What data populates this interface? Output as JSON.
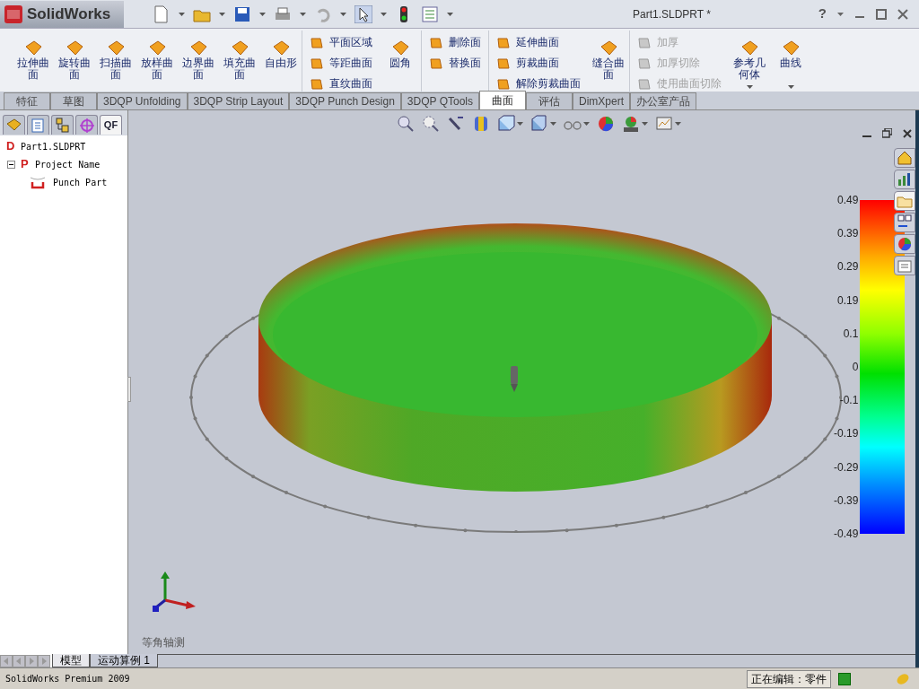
{
  "title_bar": {
    "logo": "SolidWorks",
    "title": "Part1.SLDPRT *",
    "help": "?"
  },
  "ribbon": [
    {
      "kind": "big",
      "label": "拉伸曲面",
      "disabled": false
    },
    {
      "kind": "big",
      "label": "旋转曲面",
      "disabled": false
    },
    {
      "kind": "big",
      "label": "扫描曲面",
      "disabled": false
    },
    {
      "kind": "big",
      "label": "放样曲面",
      "disabled": false
    },
    {
      "kind": "big",
      "label": "边界曲面",
      "disabled": false
    },
    {
      "kind": "big",
      "label": "填充曲面",
      "disabled": false
    },
    {
      "kind": "big",
      "label": "自由形",
      "disabled": false
    },
    {
      "kind": "column",
      "items": [
        {
          "label": "平面区域",
          "disabled": false
        },
        {
          "label": "等距曲面",
          "disabled": false
        },
        {
          "label": "直纹曲面",
          "disabled": false
        }
      ]
    },
    {
      "kind": "big",
      "label": "圆角",
      "disabled": false
    },
    {
      "kind": "column",
      "items": [
        {
          "label": "删除面",
          "disabled": false
        },
        {
          "label": "替换面",
          "disabled": false
        }
      ]
    },
    {
      "kind": "column",
      "items": [
        {
          "label": "延伸曲面",
          "disabled": false
        },
        {
          "label": "剪裁曲面",
          "disabled": false
        },
        {
          "label": "解除剪裁曲面",
          "disabled": false
        }
      ]
    },
    {
      "kind": "big",
      "label": "缝合曲面",
      "disabled": false
    },
    {
      "kind": "column",
      "items": [
        {
          "label": "加厚",
          "disabled": true
        },
        {
          "label": "加厚切除",
          "disabled": true
        },
        {
          "label": "使用曲面切除",
          "disabled": true
        }
      ]
    },
    {
      "kind": "dropdown",
      "label": "参考几何体",
      "disabled": false
    },
    {
      "kind": "dropdown",
      "label": "曲线",
      "disabled": false
    }
  ],
  "tabs": [
    {
      "label": "特征",
      "selected": false
    },
    {
      "label": "草图",
      "selected": false
    },
    {
      "label": "3DQP Unfolding",
      "selected": false
    },
    {
      "label": "3DQP Strip Layout",
      "selected": false
    },
    {
      "label": "3DQP Punch Design",
      "selected": false
    },
    {
      "label": "3DQP QTools",
      "selected": false
    },
    {
      "label": "曲面",
      "selected": true
    },
    {
      "label": "评估",
      "selected": false
    },
    {
      "label": "DimXpert",
      "selected": false
    },
    {
      "label": "办公室产品",
      "selected": false
    }
  ],
  "panel_tabs": [
    {
      "kind": "feature",
      "selected": false
    },
    {
      "kind": "property",
      "selected": false
    },
    {
      "kind": "config",
      "selected": false
    },
    {
      "kind": "target",
      "selected": false
    },
    {
      "kind": "text",
      "label": "QF",
      "selected": true
    }
  ],
  "task_pane": [
    {
      "selected": false
    },
    {
      "selected": false
    },
    {
      "selected": true
    },
    {
      "selected": false
    },
    {
      "selected": false
    },
    {
      "selected": false
    }
  ],
  "tree": [
    {
      "kind": "letter",
      "mark": "D",
      "label": "Part1.SLDPRT",
      "children": [
        {
          "kind": "letter",
          "mark": "P",
          "label": "Project Name",
          "expanded": true,
          "children": [
            {
              "kind": "punch",
              "label": "Punch Part"
            }
          ]
        }
      ]
    }
  ],
  "legend": {
    "ticks": [
      "0.49",
      "0.39",
      "0.29",
      "0.19",
      "0.1",
      "0",
      "-0.1",
      "-0.19",
      "-0.29",
      "-0.39",
      "-0.49"
    ]
  },
  "view_label": "等角轴测",
  "bottom_tabs": [
    {
      "label": "模型",
      "selected": true
    },
    {
      "label": "运动算例 1",
      "selected": false
    }
  ],
  "status_bar": {
    "product": "SolidWorks Premium 2009",
    "editing": "正在编辑：零件"
  }
}
